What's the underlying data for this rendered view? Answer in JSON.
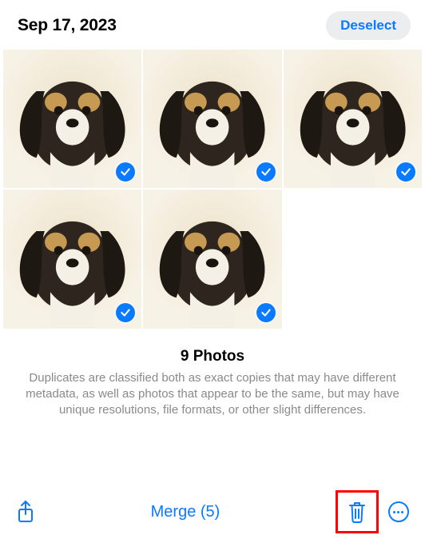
{
  "header": {
    "date_title": "Sep 17, 2023",
    "deselect_label": "Deselect"
  },
  "photos": [
    {
      "subject": "puppy",
      "selected": true
    },
    {
      "subject": "puppy",
      "selected": true
    },
    {
      "subject": "puppy",
      "selected": true
    },
    {
      "subject": "puppy",
      "selected": true
    },
    {
      "subject": "puppy",
      "selected": true
    }
  ],
  "summary": {
    "count_heading": "9 Photos",
    "description": "Duplicates are classified both as exact copies that may have different metadata, as well as photos that appear to be the same, but may have unique resolutions, file formats, or other slight differences."
  },
  "toolbar": {
    "share_icon": "share-icon",
    "merge_label": "Merge (5)",
    "trash_icon": "trash-icon",
    "more_icon": "more-icon"
  },
  "annotations": {
    "trash_highlight_color": "#ff0000"
  },
  "colors": {
    "accent": "#0a7aff",
    "muted_text": "#8a8a8e",
    "pill_bg": "#ecedee"
  }
}
